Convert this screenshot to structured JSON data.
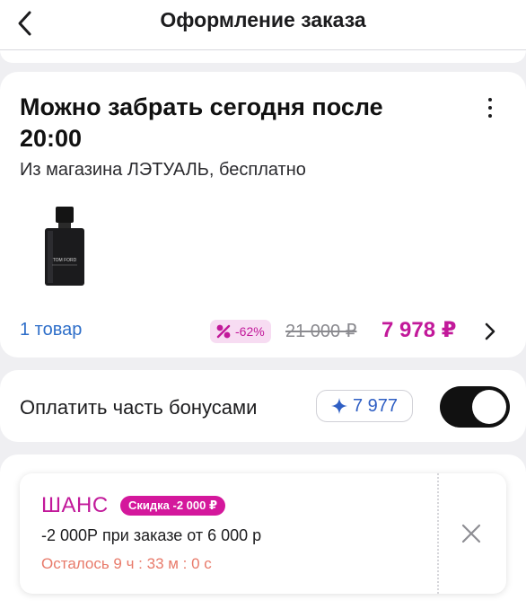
{
  "header": {
    "title": "Оформление заказа",
    "back_icon": "chevron-left-icon"
  },
  "pickup": {
    "title": "Можно забрать сегодня после 20:00",
    "subtitle": "Из магазина ЛЭТУАЛЬ, бесплатно",
    "more_icon": "more-vertical-icon",
    "product": {
      "brand_text": "TOM FORD",
      "image": "perfume-bottle"
    },
    "items_link": "1 товар",
    "discount_icon": "percent-icon",
    "discount": "-62%",
    "old_price": "21 000 ₽",
    "new_price": "7 978 ₽",
    "chevron_icon": "chevron-right-icon"
  },
  "bonus": {
    "label": "Оплатить часть бонусами",
    "star_icon": "sparkle-icon",
    "balance": "7 977",
    "toggle_on": true
  },
  "promo": {
    "name": "ШАНС",
    "badge": "Скидка -2 000 ₽",
    "description": "-2 000Р при заказе от 6 000 р",
    "timer": "Осталось 9 ч : 33 м : 0 с",
    "close_icon": "close-icon"
  },
  "colors": {
    "accent": "#c2199a",
    "link": "#2f6fc9",
    "timer": "#e87a6a",
    "background": "#efeff2"
  }
}
